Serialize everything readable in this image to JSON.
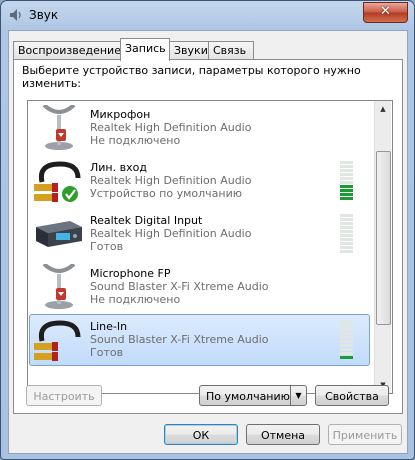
{
  "window": {
    "title": "Звук",
    "close_glyph": "✕"
  },
  "tabs": [
    {
      "label": "Воспроизведение",
      "active": false
    },
    {
      "label": "Запись",
      "active": true
    },
    {
      "label": "Звуки",
      "active": false
    },
    {
      "label": "Связь",
      "active": false
    }
  ],
  "description": "Выберите устройство записи, параметры которого нужно изменить:",
  "devices": [
    {
      "name": "Микрофон",
      "driver": "Realtek High Definition Audio",
      "status": "Не подключено",
      "icon": "microphone-icon",
      "badge": "unplugged-badge",
      "meter_level": null,
      "selected": false
    },
    {
      "name": "Лин. вход",
      "driver": "Realtek High Definition Audio",
      "status": "Устройство по умолчанию",
      "icon": "line-in-cable-icon",
      "badge": "default-check-badge",
      "meter_level": 0.4,
      "selected": false
    },
    {
      "name": "Realtek Digital Input",
      "driver": "Realtek High Definition Audio",
      "status": "Готов",
      "icon": "digital-input-icon",
      "badge": null,
      "meter_level": 0.0,
      "selected": false
    },
    {
      "name": "Microphone FP",
      "driver": "Sound Blaster X-Fi Xtreme Audio",
      "status": "Не подключено",
      "icon": "microphone-icon",
      "badge": "unplugged-badge",
      "meter_level": null,
      "selected": false
    },
    {
      "name": "Line-In",
      "driver": "Sound Blaster X-Fi Xtreme Audio",
      "status": "Готов",
      "icon": "line-in-cable-icon",
      "badge": null,
      "meter_level": 0.1,
      "selected": true
    }
  ],
  "buttons": {
    "configure": "Настроить",
    "set_default": "По умолчанию",
    "set_default_arrow": "▼",
    "properties": "Свойства",
    "ok": "ОК",
    "cancel": "Отмена",
    "apply": "Применить"
  },
  "scrollbar": {
    "up_glyph": "▲",
    "down_glyph": "▼"
  },
  "colors": {
    "meter_on": "#1b9c33",
    "meter_off": "#e0e6e1",
    "selection": "#c1dbfc",
    "close_red": "#c75a45"
  }
}
